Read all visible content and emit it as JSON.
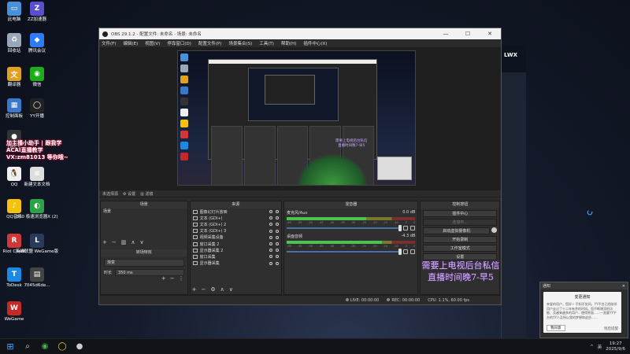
{
  "desktop": {
    "icons": [
      {
        "label": "此电脑",
        "color": "#4a90d9",
        "glyph": "▭"
      },
      {
        "label": "ZZ加速器",
        "color": "#5a4fcf",
        "glyph": "Z"
      },
      {
        "label": "回收站",
        "color": "#9aa7b8",
        "glyph": "♻"
      },
      {
        "label": "腾讯会议",
        "color": "#2d7cf6",
        "glyph": "◆"
      },
      {
        "label": "翻译器",
        "color": "#e0a020",
        "glyph": "文"
      },
      {
        "label": "微信",
        "color": "#1aad19",
        "glyph": "◉"
      },
      {
        "label": "控制面板",
        "color": "#3a78c9",
        "glyph": "▦"
      },
      {
        "label": "YY开播",
        "color": "#222222",
        "glyph": "◯"
      },
      {
        "label": "OBS S",
        "color": "#333333",
        "glyph": "●"
      },
      {
        "label": "QQ",
        "color": "#f0f0f0",
        "glyph": "🐧"
      },
      {
        "label": "新建文本文档",
        "color": "#dddddd",
        "glyph": "≡"
      },
      {
        "label": "QQ音乐",
        "color": "#f4c20d",
        "glyph": "♪"
      },
      {
        "label": "360 极速浏览器X (2)",
        "color": "#2ba245",
        "glyph": "◐"
      },
      {
        "label": "Riot Client",
        "color": "#d13639",
        "glyph": "R"
      },
      {
        "label": "英雄联盟 WeGame版",
        "color": "#2a3a5a",
        "glyph": "L"
      },
      {
        "label": "ToDesk",
        "color": "#1e88e5",
        "glyph": "T"
      },
      {
        "label": "7045d6de...",
        "color": "#444444",
        "glyph": "▤"
      },
      {
        "label": "WeGame",
        "color": "#c62828",
        "glyph": "W"
      }
    ],
    "overlay_text": "加主播小助手 | 跟我学 ACAI直播教学 VX:zm81013 等你哦~"
  },
  "bg_window": {
    "title": "LWX"
  },
  "obs": {
    "title": "OBS 29.1.2 - 配置文件: 未命名 - 场景: 未命名",
    "window_controls": [
      "—",
      "☐",
      "✕"
    ],
    "menu": [
      "文件(F)",
      "编辑(E)",
      "视图(V)",
      "停靠窗口(D)",
      "配置文件(P)",
      "场景集合(S)",
      "工具(T)",
      "帮助(H)",
      "插件中心(X)"
    ],
    "context_bar": {
      "label": "未选择源",
      "buttons": [
        "⚙ 设置",
        "▥ 滤镜"
      ]
    },
    "preview_promo": [
      "需要上电视后台私信",
      "直播时间晚7-早5"
    ],
    "scenes": {
      "title": "场景",
      "items": [
        "场景"
      ]
    },
    "sources": {
      "title": "来源",
      "items": [
        "图像幻灯片放映",
        "文本 (GDI+)",
        "文本 (GDI+) 2",
        "文本 (GDI+) 3",
        "视频采集设备",
        "窗口采集 2",
        "显示器采集 2",
        "窗口采集",
        "显示器采集"
      ]
    },
    "transitions": {
      "title": "转场特效",
      "selected": "渐变",
      "duration_label": "时长",
      "duration_value": "350 ms"
    },
    "mixer": {
      "title": "混音器",
      "channels": [
        {
          "name": "麦克风/Aux",
          "db": "0.0 dB",
          "level": 0.62
        },
        {
          "name": "桌面音频",
          "db": "-4.3 dB",
          "level": 0.74
        }
      ],
      "ticks": [
        "-60",
        "-55",
        "-50",
        "-45",
        "-40",
        "-35",
        "-30",
        "-25",
        "-20",
        "-15",
        "-10",
        "-5",
        "0"
      ]
    },
    "controls": {
      "title": "控制按钮",
      "buttons": [
        "插件中心",
        "连接中...",
        "启动虚拟摄像机",
        "开始录制",
        "工作室模式",
        "设置"
      ]
    },
    "promo": [
      "需要上电视后台私信",
      "直播时间晚7-早5"
    ],
    "status": {
      "live": "LIVE: 00:00:00",
      "rec": "REC: 00:00:00",
      "cpu": "CPU: 1.1%, 60.00 fps"
    }
  },
  "notification": {
    "title": "通知",
    "heading": "变更通知",
    "body": "亲爱的用户，您好~ 不知不觉间，YY平台已经陪伴用户走过了十二年有余的时间。而不断增添的功能、及越来越多的用户，使得界面……一直重YY平台的YY人及所以我的梦想和这些……",
    "button": "我同意",
    "later": "稍后提醒"
  },
  "taskbar": {
    "icons": [
      "⊞",
      "⌕",
      "◉",
      "◯",
      "●"
    ],
    "tray": [
      "^",
      "英"
    ],
    "time": "19:27",
    "date": "2025/9/6"
  }
}
